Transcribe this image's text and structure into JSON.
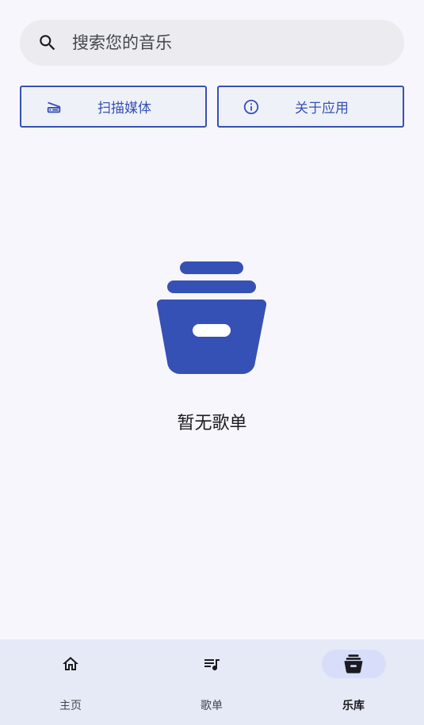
{
  "search": {
    "placeholder": "搜索您的音乐",
    "icon": "search-icon"
  },
  "actions": {
    "scan_label": "扫描媒体",
    "scan_icon": "scanner-icon",
    "about_label": "关于应用",
    "about_icon": "info-icon"
  },
  "empty_state": {
    "icon": "archive-box-icon",
    "message": "暂无歌单"
  },
  "nav": {
    "items": [
      {
        "label": "主页",
        "icon": "home-icon"
      },
      {
        "label": "歌单",
        "icon": "playlist-icon"
      },
      {
        "label": "乐库",
        "icon": "library-icon",
        "active": true
      }
    ]
  },
  "colors": {
    "accent": "#3651b5",
    "background": "#f7f6fc",
    "nav_background": "#e6e9f6",
    "active_pill": "#d8defa"
  }
}
